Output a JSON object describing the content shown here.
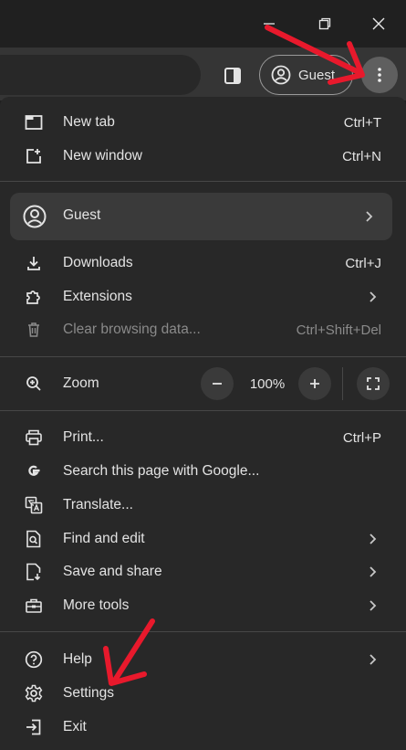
{
  "window": {
    "controls": [
      "minimize",
      "restore",
      "close"
    ]
  },
  "toolbar": {
    "profile_label": "Guest"
  },
  "menu": {
    "new_tab": {
      "label": "New tab",
      "shortcut": "Ctrl+T"
    },
    "new_window": {
      "label": "New window",
      "shortcut": "Ctrl+N"
    },
    "guest": {
      "label": "Guest"
    },
    "downloads": {
      "label": "Downloads",
      "shortcut": "Ctrl+J"
    },
    "extensions": {
      "label": "Extensions"
    },
    "clear_browsing": {
      "label": "Clear browsing data...",
      "shortcut": "Ctrl+Shift+Del"
    },
    "zoom": {
      "label": "Zoom",
      "minus": "−",
      "value": "100%",
      "plus": "+"
    },
    "print": {
      "label": "Print...",
      "shortcut": "Ctrl+P"
    },
    "search_google": {
      "label": "Search this page with Google..."
    },
    "translate": {
      "label": "Translate..."
    },
    "find_edit": {
      "label": "Find and edit"
    },
    "save_share": {
      "label": "Save and share"
    },
    "more_tools": {
      "label": "More tools"
    },
    "help": {
      "label": "Help"
    },
    "settings": {
      "label": "Settings"
    },
    "exit": {
      "label": "Exit"
    }
  },
  "colors": {
    "menu_bg": "#282828",
    "toolbar_bg": "#353535",
    "annotation_red": "#e8192c"
  }
}
